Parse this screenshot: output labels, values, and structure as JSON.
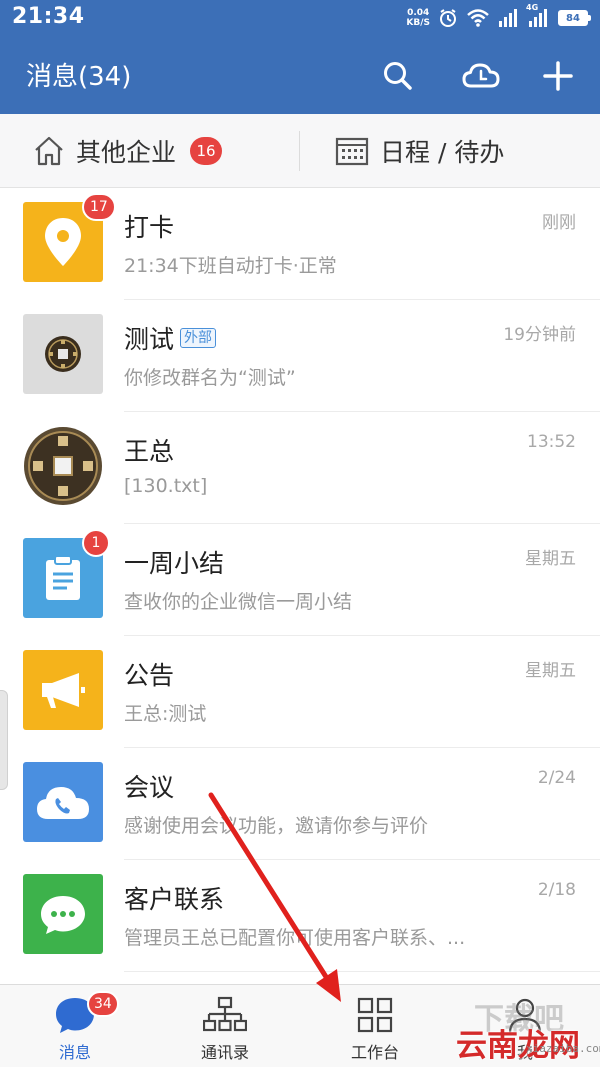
{
  "status_bar": {
    "time": "21:34",
    "net_speed_value": "0.04",
    "net_speed_unit": "KB/S",
    "network_type": "4G",
    "battery": "84"
  },
  "header": {
    "title": "消息(34)",
    "color": "#3c6fb7"
  },
  "quick_bar": {
    "other_companies_label": "其他企业",
    "other_companies_badge": "16",
    "schedule_label": "日程 / 待办"
  },
  "messages": [
    {
      "name": "打卡",
      "time": "刚刚",
      "preview": "21:34下班自动打卡·正常",
      "badge": "17",
      "icon": "location-pin-icon",
      "color": "#f5b31b"
    },
    {
      "name": "测试",
      "tag": "外部",
      "time": "19分钟前",
      "preview": "你修改群名为“测试”",
      "icon": "coin-avatar",
      "color": "#dcdcdc"
    },
    {
      "name": "王总",
      "time": "13:52",
      "preview": "[130.txt]",
      "icon": "coin-avatar",
      "color": "#6b5a3a"
    },
    {
      "name": "一周小结",
      "time": "星期五",
      "preview": "查收你的企业微信一周小结",
      "badge": "1",
      "icon": "clipboard-icon",
      "color": "#4aa3df"
    },
    {
      "name": "公告",
      "time": "星期五",
      "preview": "王总:测试",
      "icon": "megaphone-icon",
      "color": "#f5b31b"
    },
    {
      "name": "会议",
      "time": "2/24",
      "preview": "感谢使用会议功能，邀请你参与评价",
      "icon": "cloud-phone-icon",
      "color": "#4a8fe0"
    },
    {
      "name": "客户联系",
      "time": "2/18",
      "preview": "管理员王总已配置你可使用客户联系、...",
      "icon": "chat-bubble-icon",
      "color": "#3db24b"
    }
  ],
  "bottom_nav": [
    {
      "label": "消息",
      "badge": "34",
      "icon": "chat-icon",
      "active": true
    },
    {
      "label": "通讯录",
      "icon": "org-chart-icon"
    },
    {
      "label": "工作台",
      "icon": "grid-icon"
    },
    {
      "label": "我",
      "icon": "person-icon"
    }
  ],
  "watermark": {
    "main": "云南龙网",
    "sub": "xiazaiba.com"
  }
}
